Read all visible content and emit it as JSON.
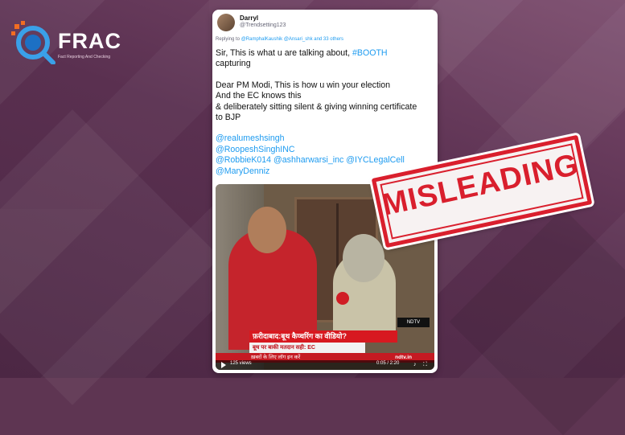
{
  "brand": {
    "name": "FRAC",
    "tagline": "Fact Reporting And Checking"
  },
  "tweet": {
    "user_name": "Darryl",
    "user_handle": "@Trendsetting123",
    "replying_prefix": "Replying to",
    "replying_users": "@RamphalKaushik @Ansari_shk and 33 others",
    "line1": "Sir, This is what u are talking about,",
    "hashtag": "#BOOTH",
    "line2": "capturing",
    "para2_l1": "Dear PM Modi, This is how u win your election",
    "para2_l2": "And the EC knows this",
    "para2_l3": "& deliberately sitting silent & giving winning certificate",
    "para2_l4": "to BJP",
    "mention1": "@realumeshsingh",
    "mention2": "@RoopeshSinghINC",
    "mention3": "@RobbieK014 @ashharwarsi_inc @IYCLegalCell",
    "mention4": "@MaryDenniz"
  },
  "video": {
    "headline": "फ़रीदाबाद:बूथ कैप्चरिंग का वीडियो?",
    "subline": "बूथ पर बाकी मतदान सही: EC",
    "ticker": "ख़बरों के लिए लॉग इन करें",
    "ticker_site": "ndtv.in",
    "logo": "NDTV",
    "views": "125 views",
    "time": "0:05 / 2:20"
  },
  "stamp": {
    "label": "MISLEADING",
    "color": "#d91f2d"
  },
  "colors": {
    "background": "#5e3552",
    "link": "#1d9bf0"
  }
}
